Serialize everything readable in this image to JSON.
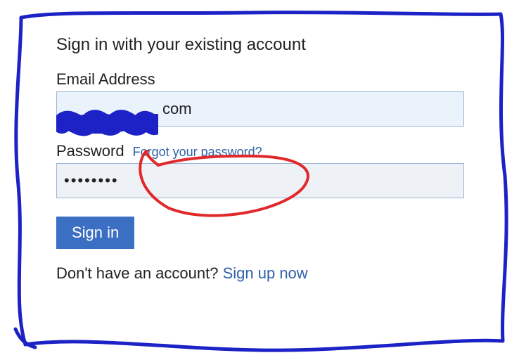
{
  "form": {
    "title": "Sign in with your existing account",
    "email_label": "Email Address",
    "email_value_visible": "com",
    "password_label": "Password",
    "forgot_link": "Forgot your password?",
    "password_value": "••••••••",
    "signin_button": "Sign in",
    "no_account_text": "Don't have an account? ",
    "signup_link": "Sign up now"
  },
  "colors": {
    "link": "#3061a8",
    "button": "#3b6fc4",
    "input_bg": "#eaf2fb",
    "annotation_blue": "#1c22c6",
    "annotation_red": "#e1282a"
  }
}
